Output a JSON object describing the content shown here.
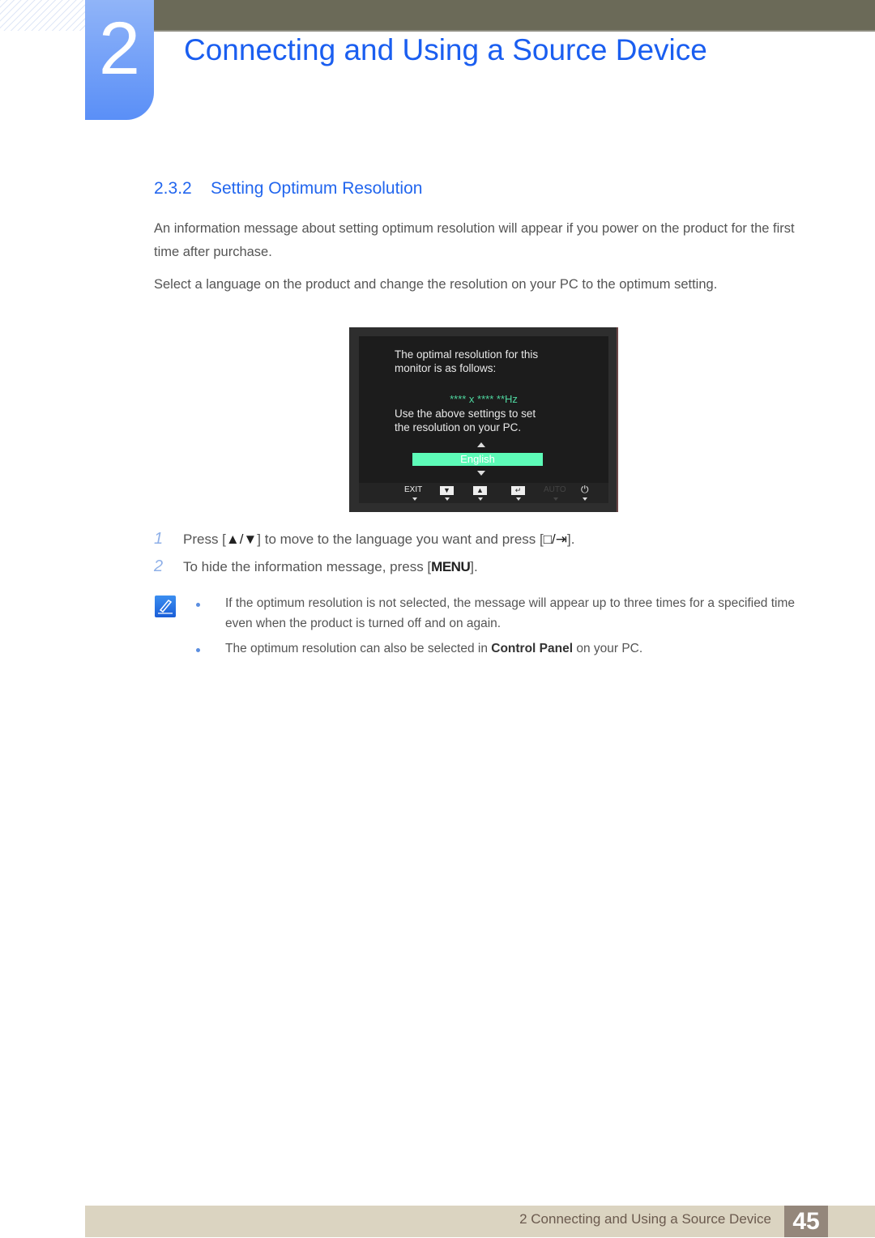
{
  "header": {
    "chapter_number": "2",
    "chapter_title": "Connecting and Using a Source Device"
  },
  "section": {
    "number": "2.3.2",
    "title": "Setting Optimum Resolution"
  },
  "paragraphs": [
    "An information message about setting optimum resolution will appear if you power on the product for the first time after purchase.",
    "Select a language on the product and change the resolution on your PC to the optimum setting."
  ],
  "osd": {
    "line1": "The optimal resolution for this",
    "line2": "monitor is as follows:",
    "resolution": "**** x ****  **Hz",
    "line3": "Use the above settings to set",
    "line4": "the resolution on your PC.",
    "language": "English",
    "buttons": {
      "exit": "EXIT",
      "down": "▼",
      "up": "▲",
      "enter": "↵",
      "auto": "AUTO",
      "power": "⏻"
    }
  },
  "steps": [
    {
      "num": "1",
      "pre": "Press [",
      "keys1": "▲/▼",
      "mid": "] to move to the language you want and press [",
      "keys2": "□/⇥",
      "post": "]."
    },
    {
      "num": "2",
      "pre": "To hide the information message, press [",
      "key": "MENU",
      "post": "]."
    }
  ],
  "notes": [
    {
      "text": "If the optimum resolution is not selected, the message will appear up to three times for a specified time even when the product is turned off and on again."
    },
    {
      "pre": "The optimum resolution can also be selected in ",
      "bold": "Control Panel",
      "post": " on your PC."
    }
  ],
  "footer": {
    "text": "2 Connecting and Using a Source Device",
    "page": "45"
  }
}
